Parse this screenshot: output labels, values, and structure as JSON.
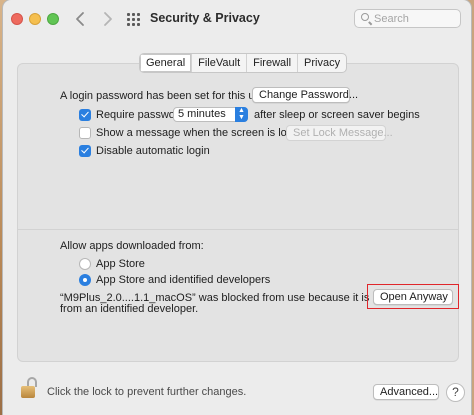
{
  "window": {
    "title": "Security & Privacy",
    "search": {
      "placeholder": "Search",
      "value": ""
    },
    "icons": [
      "close-button",
      "minimize-button",
      "zoom-button",
      "chevron-left-icon",
      "chevron-right-icon",
      "grid-icon",
      "search-icon"
    ]
  },
  "tabs": [
    {
      "label": "General",
      "selected": true
    },
    {
      "label": "FileVault",
      "selected": false
    },
    {
      "label": "Firewall",
      "selected": false
    },
    {
      "label": "Privacy",
      "selected": false
    }
  ],
  "general": {
    "login_text": "A login password has been set for this user",
    "change_password_label": "Change Password...",
    "require_password": {
      "label": "Require password",
      "checked": true,
      "interval": "5 minutes",
      "suffix": "after sleep or screen saver begins"
    },
    "show_message": {
      "label": "Show a message when the screen is locked",
      "checked": false,
      "button_label": "Set Lock Message..."
    },
    "disable_autologin": {
      "label": "Disable automatic login",
      "checked": true
    }
  },
  "allow_apps": {
    "heading": "Allow apps downloaded from:",
    "options": [
      {
        "label": "App Store",
        "selected": false
      },
      {
        "label": "App Store and identified developers",
        "selected": true
      }
    ],
    "blocked_line1": "“M9Plus_2.0....1.1_macOS” was blocked from use because it is not",
    "blocked_line2": "from an identified developer.",
    "open_anyway_label": "Open Anyway",
    "highlight_color": "#e0262b"
  },
  "footer": {
    "lock_text": "Click the lock to prevent further changes.",
    "advanced_label": "Advanced...",
    "help_label": "?"
  },
  "colors": {
    "accent": "#2a7fe0",
    "window_bg": "#ececec"
  }
}
